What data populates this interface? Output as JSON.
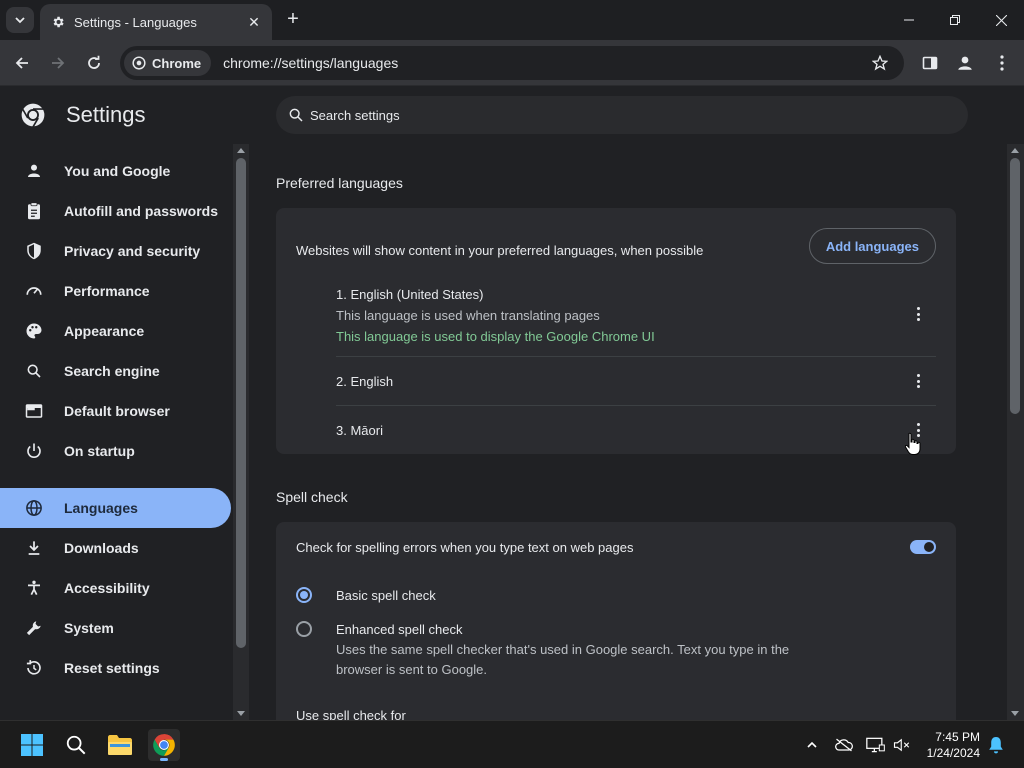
{
  "window": {
    "tab_title": "Settings - Languages",
    "new_tab_symbol": "+",
    "close_tab_symbol": "✕"
  },
  "toolbar": {
    "chip_label": "Chrome",
    "url": "chrome://settings/languages"
  },
  "settings": {
    "brand": "Settings",
    "search_placeholder": "Search settings",
    "sidebar": {
      "items": [
        {
          "label": "You and Google",
          "icon": "person-icon"
        },
        {
          "label": "Autofill and passwords",
          "icon": "clipboard-icon"
        },
        {
          "label": "Privacy and security",
          "icon": "shield-icon"
        },
        {
          "label": "Performance",
          "icon": "speedometer-icon"
        },
        {
          "label": "Appearance",
          "icon": "palette-icon"
        },
        {
          "label": "Search engine",
          "icon": "search-icon"
        },
        {
          "label": "Default browser",
          "icon": "browser-icon"
        },
        {
          "label": "On startup",
          "icon": "power-icon"
        },
        {
          "label": "Languages",
          "icon": "globe-icon",
          "active": true
        },
        {
          "label": "Downloads",
          "icon": "download-icon"
        },
        {
          "label": "Accessibility",
          "icon": "accessibility-icon"
        },
        {
          "label": "System",
          "icon": "wrench-icon"
        },
        {
          "label": "Reset settings",
          "icon": "reset-icon"
        }
      ]
    },
    "preferred": {
      "title": "Preferred languages",
      "description": "Websites will show content in your preferred languages, when possible",
      "add_button": "Add languages",
      "languages": [
        {
          "name": "1. English (United States)",
          "sub1": "This language is used when translating pages",
          "sub2": "This language is used to display the Google Chrome UI"
        },
        {
          "name": "2. English"
        },
        {
          "name": "3. Māori"
        }
      ]
    },
    "spell": {
      "title": "Spell check",
      "toggle_label": "Check for spelling errors when you type text on web pages",
      "toggle_on": true,
      "basic_label": "Basic spell check",
      "enhanced_label": "Enhanced spell check",
      "enhanced_desc_1": "Uses the same spell checker that's used in Google search. Text you type in the",
      "enhanced_desc_2": "browser is sent to Google.",
      "use_for": "Use spell check for"
    }
  },
  "taskbar": {
    "time": "7:45 PM",
    "date": "1/24/2024"
  },
  "colors": {
    "accent": "#8ab4f8",
    "green": "#81c995"
  }
}
